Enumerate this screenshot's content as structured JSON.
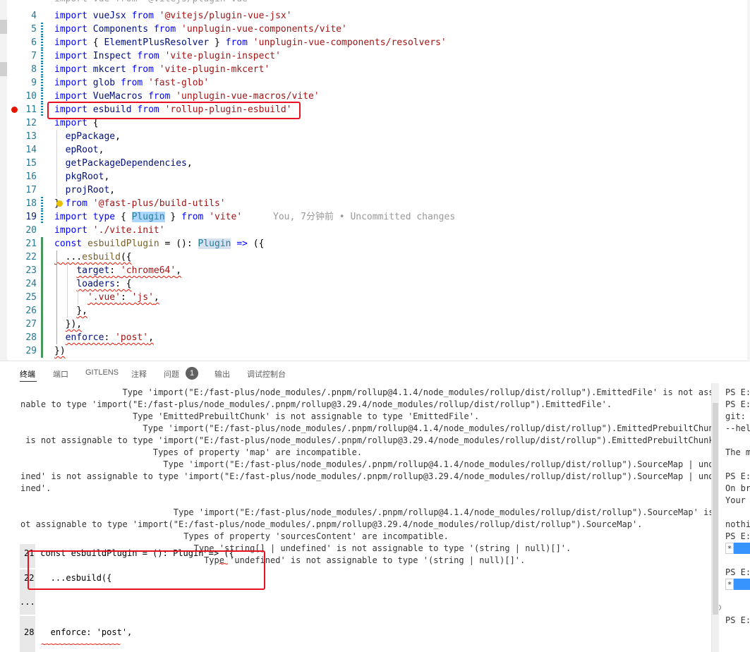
{
  "editor": {
    "top_line_fragment": "import vue from '@vitejs/plugin-vue'",
    "lines": [
      {
        "n": "4",
        "parts": [
          [
            "kw",
            "import "
          ],
          [
            "id",
            "vueJsx "
          ],
          [
            "kw",
            "from "
          ],
          [
            "str",
            "'@vitejs/plugin-vue-jsx'"
          ]
        ]
      },
      {
        "n": "5",
        "parts": [
          [
            "kw",
            "import "
          ],
          [
            "id",
            "Components "
          ],
          [
            "kw",
            "from "
          ],
          [
            "str",
            "'unplugin-vue-components/vite'"
          ]
        ]
      },
      {
        "n": "6",
        "parts": [
          [
            "kw",
            "import "
          ],
          [
            "plain",
            "{ "
          ],
          [
            "id",
            "ElementPlusResolver "
          ],
          [
            "plain",
            "} "
          ],
          [
            "kw",
            "from "
          ],
          [
            "str",
            "'unplugin-vue-components/resolvers'"
          ]
        ]
      },
      {
        "n": "7",
        "parts": [
          [
            "kw",
            "import "
          ],
          [
            "id",
            "Inspect "
          ],
          [
            "kw",
            "from "
          ],
          [
            "str",
            "'vite-plugin-inspect'"
          ]
        ]
      },
      {
        "n": "8",
        "parts": [
          [
            "kw",
            "import "
          ],
          [
            "id",
            "mkcert "
          ],
          [
            "kw",
            "from "
          ],
          [
            "str",
            "'vite-plugin-mkcert'"
          ]
        ]
      },
      {
        "n": "9",
        "parts": [
          [
            "kw",
            "import "
          ],
          [
            "id",
            "glob "
          ],
          [
            "kw",
            "from "
          ],
          [
            "str",
            "'fast-glob'"
          ]
        ]
      },
      {
        "n": "10",
        "parts": [
          [
            "kw",
            "import "
          ],
          [
            "id",
            "VueMacros "
          ],
          [
            "kw",
            "from "
          ],
          [
            "str",
            "'unplugin-vue-macros/vite'"
          ]
        ]
      },
      {
        "n": "11",
        "parts": [
          [
            "kw",
            "import "
          ],
          [
            "id",
            "esbuild "
          ],
          [
            "kw",
            "from "
          ],
          [
            "str",
            "'rollup-plugin-esbuild'"
          ]
        ]
      },
      {
        "n": "12",
        "parts": [
          [
            "kw",
            "import "
          ],
          [
            "plain",
            "{"
          ]
        ]
      },
      {
        "n": "13",
        "parts": [
          [
            "plain",
            "  "
          ],
          [
            "id",
            "epPackage"
          ],
          [
            "plain",
            ","
          ]
        ]
      },
      {
        "n": "14",
        "parts": [
          [
            "plain",
            "  "
          ],
          [
            "id",
            "epRoot"
          ],
          [
            "plain",
            ","
          ]
        ]
      },
      {
        "n": "15",
        "parts": [
          [
            "plain",
            "  "
          ],
          [
            "id",
            "getPackageDependencies"
          ],
          [
            "plain",
            ","
          ]
        ]
      },
      {
        "n": "16",
        "parts": [
          [
            "plain",
            "  "
          ],
          [
            "id",
            "pkgRoot"
          ],
          [
            "plain",
            ","
          ]
        ]
      },
      {
        "n": "17",
        "parts": [
          [
            "plain",
            "  "
          ],
          [
            "id",
            "projRoot"
          ],
          [
            "plain",
            ","
          ]
        ]
      },
      {
        "n": "18",
        "parts": [
          [
            "plain",
            "} "
          ],
          [
            "kw",
            "from "
          ],
          [
            "str",
            "'@fast-plus/build-utils'"
          ]
        ]
      },
      {
        "n": "19",
        "parts": [
          [
            "kw",
            "import "
          ],
          [
            "kw",
            "type "
          ],
          [
            "plain",
            "{ "
          ],
          [
            "typsel",
            "Plugin"
          ],
          [
            "plain",
            " } "
          ],
          [
            "kw",
            "from "
          ],
          [
            "str",
            "'vite'"
          ]
        ]
      },
      {
        "n": "20",
        "parts": [
          [
            "kw",
            "import "
          ],
          [
            "str",
            "'./vite.init'"
          ]
        ]
      },
      {
        "n": "21",
        "parts": [
          [
            "kw",
            "const "
          ],
          [
            "fn",
            "esbuildPlugin "
          ],
          [
            "plain",
            "= (): "
          ],
          [
            "typhl",
            "Plugin"
          ],
          [
            "plain",
            " "
          ],
          [
            "kw",
            "=> "
          ],
          [
            "plain",
            "({"
          ]
        ]
      },
      {
        "n": "22",
        "parts": [
          [
            "sq",
            "  ..."
          ],
          [
            "sqfn",
            "esbuild"
          ],
          [
            "sq",
            "({"
          ]
        ]
      },
      {
        "n": "23",
        "parts": [
          [
            "plain",
            "    "
          ],
          [
            "sqid",
            "target"
          ],
          [
            "sq",
            ": "
          ],
          [
            "sqstr",
            "'chrome64'"
          ],
          [
            "sq",
            ","
          ]
        ]
      },
      {
        "n": "24",
        "parts": [
          [
            "plain",
            "    "
          ],
          [
            "sqid",
            "loaders"
          ],
          [
            "sq",
            ": {"
          ]
        ]
      },
      {
        "n": "25",
        "parts": [
          [
            "plain",
            "      "
          ],
          [
            "sqstr",
            "'.vue'"
          ],
          [
            "sq",
            ": "
          ],
          [
            "sqstr",
            "'js'"
          ],
          [
            "sq",
            ","
          ]
        ]
      },
      {
        "n": "26",
        "parts": [
          [
            "plain",
            "    "
          ],
          [
            "sq",
            "},"
          ]
        ]
      },
      {
        "n": "27",
        "parts": [
          [
            "plain",
            "  "
          ],
          [
            "sq",
            "}),"
          ]
        ]
      },
      {
        "n": "28",
        "parts": [
          [
            "plain",
            "  "
          ],
          [
            "sqid",
            "enforce"
          ],
          [
            "sq",
            ": "
          ],
          [
            "sqstr",
            "'post'"
          ],
          [
            "sq",
            ","
          ]
        ]
      },
      {
        "n": "29",
        "parts": [
          [
            "sq",
            "})"
          ]
        ]
      }
    ],
    "blame_text": "You, 7分钟前 • Uncommitted changes"
  },
  "panel": {
    "tabs": [
      "终端",
      "端口",
      "GITLENS",
      "注释",
      "问题",
      "输出",
      "调试控制台"
    ],
    "problems_count": "1"
  },
  "terminal": {
    "lines": [
      "                    Type 'import(\"E:/fast-plus/node_modules/.pnpm/rollup@4.1.4/node_modules/rollup/dist/rollup\").EmittedFile' is not assig",
      "nable to type 'import(\"E:/fast-plus/node_modules/.pnpm/rollup@3.29.4/node_modules/rollup/dist/rollup\").EmittedFile'.",
      "                      Type 'EmittedPrebuiltChunk' is not assignable to type 'EmittedFile'.",
      "                        Type 'import(\"E:/fast-plus/node_modules/.pnpm/rollup@4.1.4/node_modules/rollup/dist/rollup\").EmittedPrebuiltChunk'",
      " is not assignable to type 'import(\"E:/fast-plus/node_modules/.pnpm/rollup@3.29.4/node_modules/rollup/dist/rollup\").EmittedPrebuiltChunk'.",
      "                          Types of property 'map' are incompatible.",
      "                            Type 'import(\"E:/fast-plus/node_modules/.pnpm/rollup@4.1.4/node_modules/rollup/dist/rollup\").SourceMap | undef",
      "ined' is not assignable to type 'import(\"E:/fast-plus/node_modules/.pnpm/rollup@3.29.4/node_modules/rollup/dist/rollup\").SourceMap | undef",
      "ined'.",
      "",
      "                              Type 'import(\"E:/fast-plus/node_modules/.pnpm/rollup@4.1.4/node_modules/rollup/dist/rollup\").SourceMap' is n",
      "ot assignable to type 'import(\"E:/fast-plus/node_modules/.pnpm/rollup@3.29.4/node_modules/rollup/dist/rollup\").SourceMap'.",
      "                                Types of property 'sourcesContent' are incompatible.",
      "                                  Type 'string[] | undefined' is not assignable to type '(string | null)[]'.",
      "                                    Type 'undefined' is not assignable to type '(string | null)[]'."
    ],
    "snippet": {
      "line21_num": "21",
      "line21_text": " const esbuildPlugin = (): Plugin => ({",
      "line22_num": "22",
      "line22_text": "   ...esbuild({",
      "ellipsis": "...",
      "line28_num": "28",
      "line28_text": "   enforce: 'post',",
      "squiggle_short": "~~",
      "squiggle_22": "~~~~~~~~~~~~~~",
      "squiggle_28": "~~~~~~~~~~~~~~~~~~"
    }
  },
  "side_terminal": {
    "lines": [
      "PS E:",
      "PS E:",
      "git:",
      "--hel",
      "",
      "The m",
      "",
      "PS E:",
      "On br",
      "Your",
      "",
      "nothi",
      "PS E:",
      "",
      "",
      "PS E:",
      "",
      "",
      "",
      "PS E:",
      "",
      "",
      "PS E:"
    ],
    "badge_glyph": "*"
  }
}
